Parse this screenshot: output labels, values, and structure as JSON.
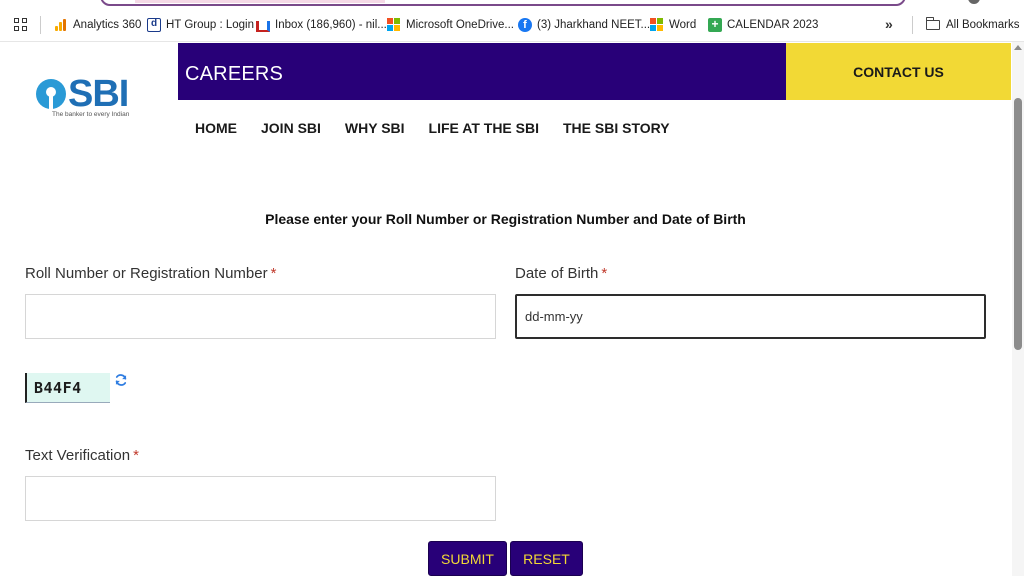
{
  "bookmarks": [
    {
      "label": "Analytics 360",
      "icon": "analytics-icon"
    },
    {
      "label": "HT Group : Login",
      "icon": "ht-icon"
    },
    {
      "label": "Inbox (186,960) - nil...",
      "icon": "gmail-icon"
    },
    {
      "label": "Microsoft OneDrive...",
      "icon": "microsoft-icon"
    },
    {
      "label": "(3) Jharkhand NEET...",
      "icon": "facebook-icon"
    },
    {
      "label": "Word",
      "icon": "microsoft-icon"
    },
    {
      "label": "CALENDAR 2023",
      "icon": "calendar-icon"
    }
  ],
  "bookmarks_more": "»",
  "all_bookmarks": "All Bookmarks",
  "brand": {
    "logo_text": "SBI",
    "tagline": "The banker to every Indian",
    "primary_color": "#280078",
    "accent_color": "#f2d935",
    "logo_color": "#2a9ad6"
  },
  "header": {
    "title": "CAREERS",
    "contact": "CONTACT US"
  },
  "nav": [
    "HOME",
    "JOIN SBI",
    "WHY SBI",
    "LIFE AT THE SBI",
    "THE SBI STORY"
  ],
  "form": {
    "instruction": "Please enter your Roll Number or Registration Number and Date of Birth",
    "roll": {
      "label": "Roll Number or Registration Number",
      "required": "*",
      "value": "",
      "placeholder": ""
    },
    "dob": {
      "label": "Date of Birth",
      "required": "*",
      "value": "",
      "placeholder": "dd-mm-yy"
    },
    "captcha": {
      "code": "B44F4",
      "refresh_icon": "refresh-icon"
    },
    "verification": {
      "label": "Text Verification",
      "required": "*",
      "value": "",
      "placeholder": ""
    },
    "submit": "SUBMIT",
    "reset": "RESET"
  }
}
